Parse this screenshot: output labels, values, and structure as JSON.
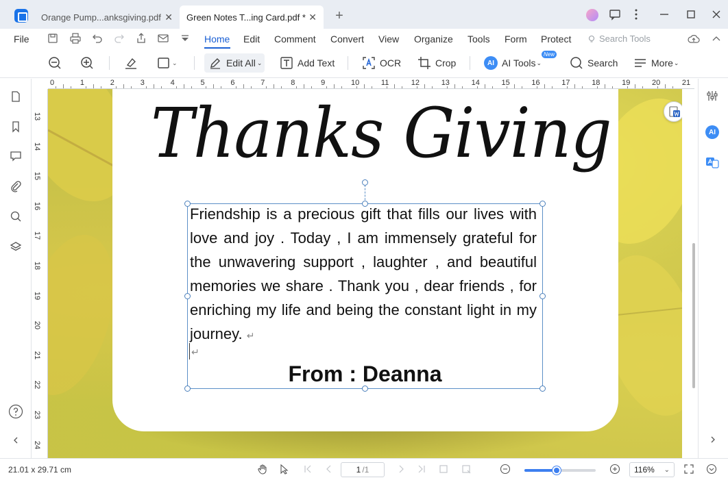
{
  "window": {
    "tabs": [
      {
        "label": "Orange  Pump...anksgiving.pdf"
      },
      {
        "label": "Green  Notes  T...ing Card.pdf *"
      }
    ]
  },
  "menu": {
    "file": "File",
    "items": [
      "Home",
      "Edit",
      "Comment",
      "Convert",
      "View",
      "Organize",
      "Tools",
      "Form",
      "Protect"
    ],
    "active": "Home",
    "search_tools_placeholder": "Search Tools"
  },
  "toolbar": {
    "edit_all": "Edit All",
    "add_text": "Add Text",
    "ocr": "OCR",
    "crop": "Crop",
    "ai_tools": "AI Tools",
    "ai_badge": "AI",
    "new_badge": "New",
    "search": "Search",
    "more": "More"
  },
  "rulers": {
    "horizontal": [
      "0",
      "1",
      "2",
      "3",
      "4",
      "5",
      "6",
      "7",
      "8",
      "9",
      "10",
      "11",
      "12",
      "13",
      "14",
      "15",
      "16",
      "17",
      "18",
      "19",
      "20",
      "21"
    ],
    "vertical": [
      "13",
      "14",
      "15",
      "16",
      "17",
      "18",
      "19",
      "20",
      "21",
      "22",
      "23",
      "24"
    ]
  },
  "document": {
    "title": "Thanks Giving",
    "body": "Friendship  is a precious  gift that fills our lives with  love  and  joy . Today  , I am  immensely grateful  for the unwavering  support , laughter , and beautiful  memories  we share . Thank  you , dear friends , for enriching  my life and being the constant light in my journey.",
    "paragraph_mark": "↵",
    "from": "From : Deanna"
  },
  "right_sidebar": {
    "ai_label": "AI"
  },
  "status": {
    "page_size": "21.01 x 29.71 cm",
    "current_page": "1",
    "total_pages": "/1",
    "zoom": "116%",
    "zoom_level": 0.45
  },
  "colors": {
    "accent": "#1a5fd4",
    "selection": "#5b8fc7",
    "background_leaves": "#c9c249"
  }
}
